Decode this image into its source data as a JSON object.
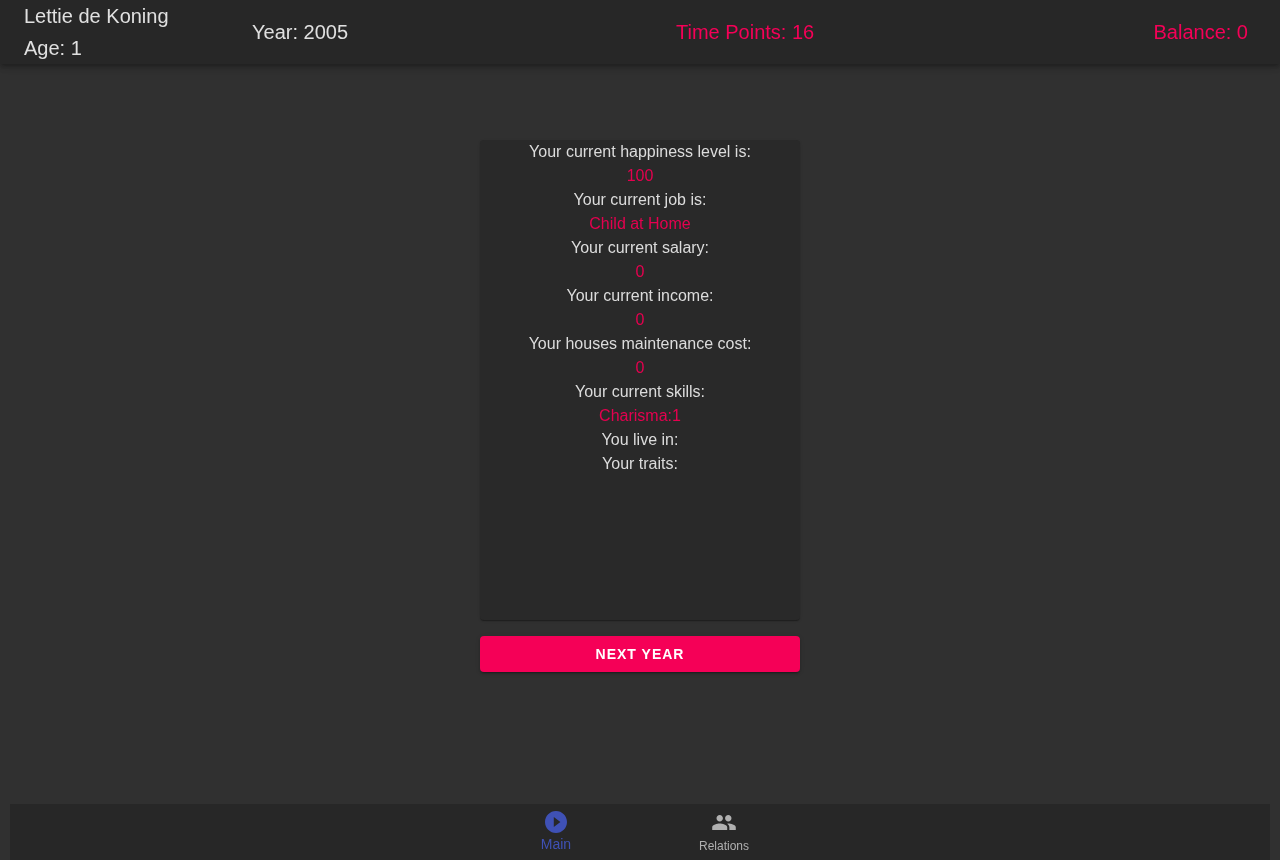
{
  "header": {
    "name": "Lettie de Koning",
    "age": "Age: 1",
    "year": "Year: 2005",
    "time_points": "Time Points: 16",
    "balance": "Balance: 0"
  },
  "status_card": {
    "rows": [
      {
        "label": "Your current happiness level is:",
        "value": "100"
      },
      {
        "label": "Your current job is:",
        "value": "Child at Home"
      },
      {
        "label": "Your current salary:",
        "value": "0"
      },
      {
        "label": "Your current income:",
        "value": "0"
      },
      {
        "label": "Your houses maintenance cost:",
        "value": "0"
      },
      {
        "label": "Your current skills:",
        "value": "Charisma:1"
      },
      {
        "label": "You live in:"
      },
      {
        "label": "Your traits:"
      }
    ]
  },
  "next_year_button": "NEXT YEAR",
  "bottom_nav": [
    {
      "label": "Main",
      "selected": true
    },
    {
      "label": "Relations",
      "selected": false
    }
  ]
}
